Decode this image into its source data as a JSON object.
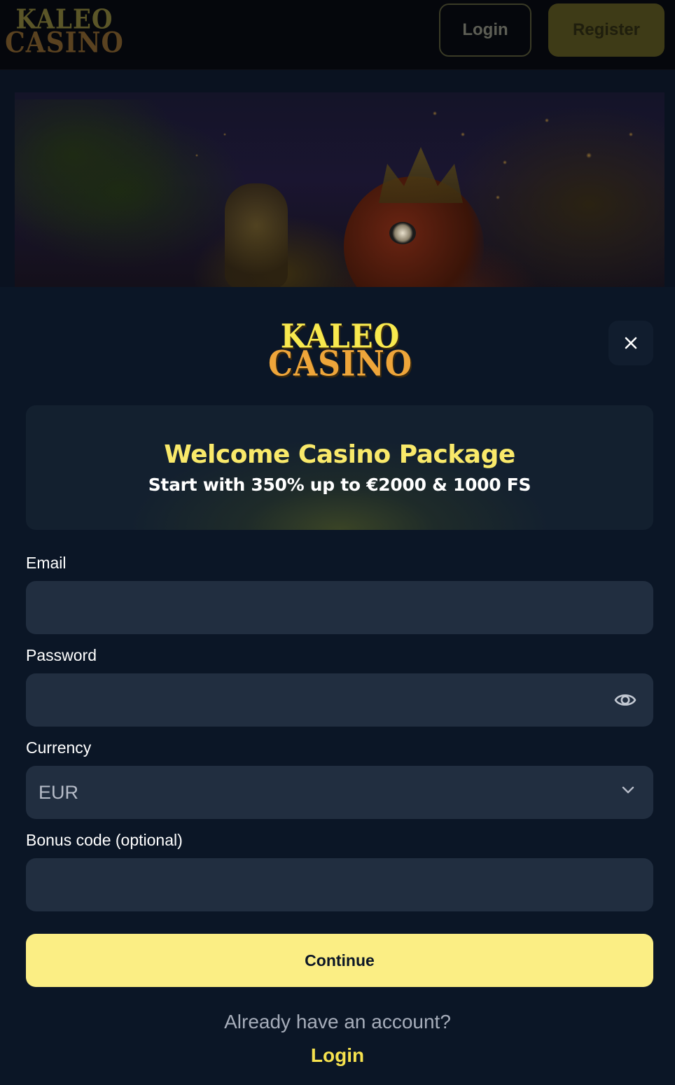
{
  "header": {
    "logo_line1": "KALEO",
    "logo_line2": "CASINO",
    "login_label": "Login",
    "register_label": "Register"
  },
  "banner": {
    "image": "parrot-king-jungle-banner"
  },
  "modal": {
    "logo_line1": "KALEO",
    "logo_line2": "CASINO",
    "close_icon": "close-icon",
    "promo": {
      "title": "Welcome Casino Package",
      "subtitle": "Start with 350% up to €2000 & 1000 FS"
    },
    "form": {
      "email_label": "Email",
      "email_value": "",
      "password_label": "Password",
      "password_value": "",
      "password_toggle_icon": "eye-icon",
      "currency_label": "Currency",
      "currency_value": "EUR",
      "currency_icon": "chevron-down-icon",
      "bonus_label": "Bonus code (optional)",
      "bonus_value": ""
    },
    "continue_label": "Continue",
    "already_text": "Already have an account?",
    "login_link": "Login"
  },
  "colors": {
    "background": "#0b1626",
    "field_bg": "#212e40",
    "accent_yellow": "#fbee84",
    "promo_title": "#f9e96a",
    "link_yellow": "#f6e24e"
  }
}
